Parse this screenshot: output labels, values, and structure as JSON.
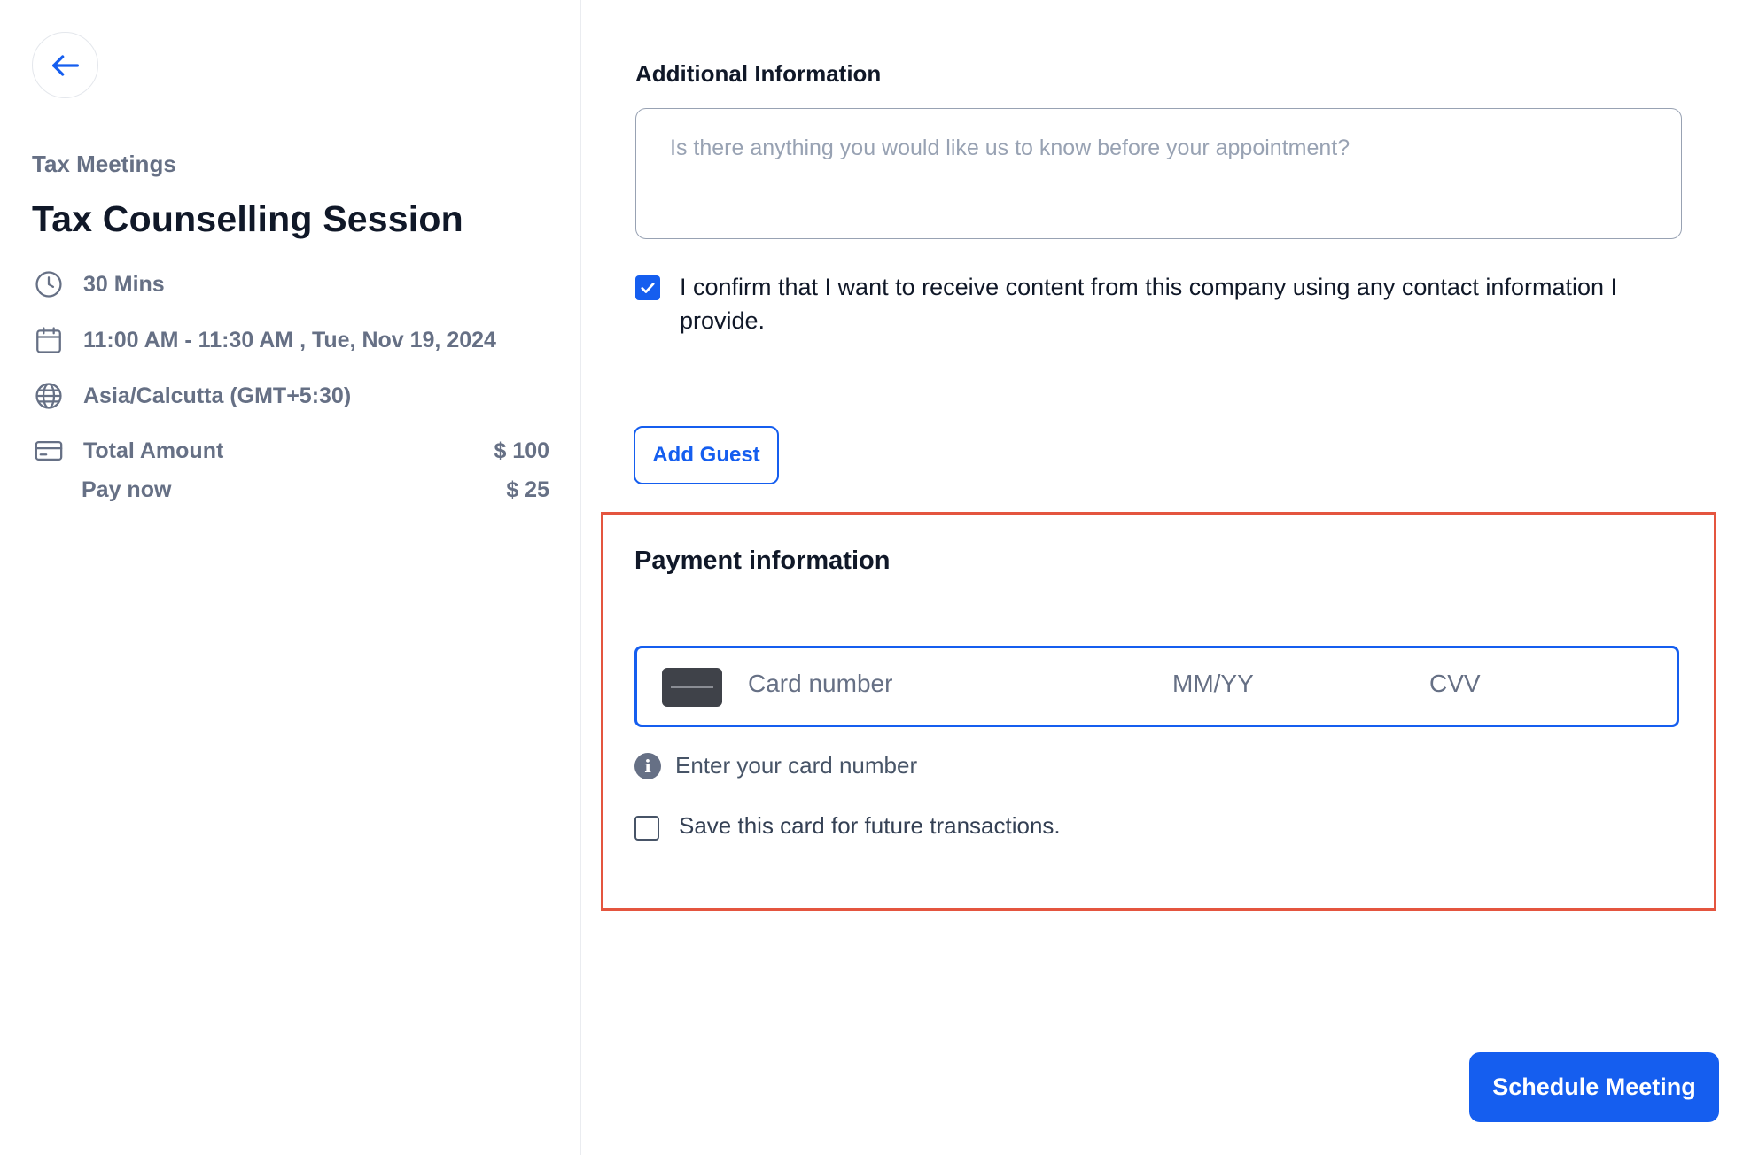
{
  "event": {
    "calendar_name": "Tax Meetings",
    "title": "Tax Counselling Session",
    "duration": "30 Mins",
    "datetime": "11:00 AM - 11:30 AM , Tue, Nov 19, 2024",
    "timezone": "Asia/Calcutta (GMT+5:30)",
    "total_label": "Total Amount",
    "total_value": "$ 100",
    "paynow_label": "Pay now",
    "paynow_value": "$ 25"
  },
  "form": {
    "additional_label": "Additional Information",
    "additional_placeholder": "Is there anything you would like us to know before your appointment?",
    "consent_text": "I confirm that I want to receive content from this company using any contact information I provide.",
    "consent_checked": true,
    "add_guest_label": "Add Guest"
  },
  "payment": {
    "title": "Payment information",
    "card_number_placeholder": "Card number",
    "expiry_placeholder": "MM/YY",
    "cvv_placeholder": "CVV",
    "hint": "Enter your card number",
    "save_card_label": "Save this card for future transactions.",
    "save_card_checked": false
  },
  "actions": {
    "schedule_label": "Schedule Meeting"
  },
  "colors": {
    "primary": "#155eef",
    "highlight_border": "#e4553f",
    "muted_text": "#667085"
  },
  "icons": [
    "arrow-left-icon",
    "clock-icon",
    "calendar-icon",
    "globe-icon",
    "credit-card-icon",
    "check-icon",
    "info-icon"
  ]
}
